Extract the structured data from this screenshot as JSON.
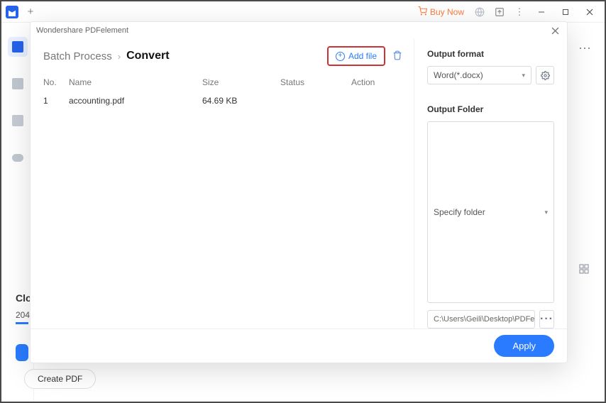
{
  "titlebar": {
    "buy_now": "Buy Now"
  },
  "background": {
    "text1": "Clo",
    "text2": "204",
    "create_pdf": "Create PDF"
  },
  "dialog": {
    "title": "Wondershare PDFelement",
    "breadcrumb": {
      "a": "Batch Process",
      "b": "Convert"
    },
    "add_file": "Add file",
    "columns": {
      "no": "No.",
      "name": "Name",
      "size": "Size",
      "status": "Status",
      "action": "Action"
    },
    "rows": [
      {
        "no": "1",
        "name": "accounting.pdf",
        "size": "64.69 KB",
        "status": "",
        "action": ""
      }
    ],
    "right": {
      "output_format_label": "Output format",
      "output_format_value": "Word(*.docx)",
      "output_folder_label": "Output Folder",
      "folder_select": "Specify folder",
      "folder_path": "C:\\Users\\Geili\\Desktop\\PDFelement\\Cc"
    },
    "apply": "Apply"
  }
}
